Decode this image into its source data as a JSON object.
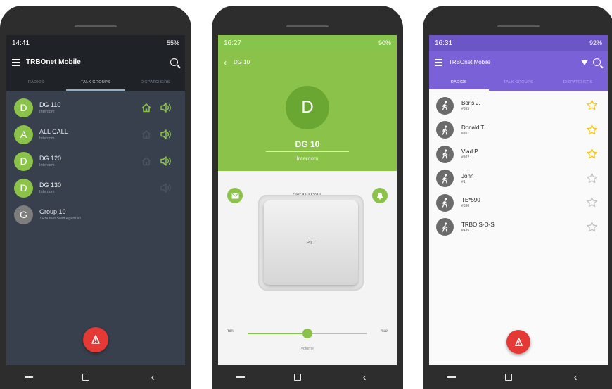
{
  "colors": {
    "dark_bg": "#37404c",
    "green": "#8bc34a",
    "purple": "#7b61d8",
    "red": "#e53935",
    "star_gold": "#f9c910"
  },
  "screen1": {
    "status": {
      "time": "14:41",
      "right": "55%"
    },
    "app_title": "TRBOnet Mobile",
    "tabs": [
      "RADIOS",
      "TALK GROUPS",
      "DISPATCHERS"
    ],
    "active_tab": "TALK GROUPS",
    "groups": [
      {
        "letter": "D",
        "name": "DG 110",
        "sub": "Intercom",
        "color": "#8bc34a",
        "house": "active",
        "speaker": "active"
      },
      {
        "letter": "A",
        "name": "ALL CALL",
        "sub": "Intercom",
        "color": "#8bc34a",
        "house": "dim",
        "speaker": "active"
      },
      {
        "letter": "D",
        "name": "DG 120",
        "sub": "Intercom",
        "color": "#8bc34a",
        "house": "dim",
        "speaker": "active"
      },
      {
        "letter": "D",
        "name": "DG 130",
        "sub": "Intercom",
        "color": "#8bc34a",
        "house": "none",
        "speaker": "dim"
      },
      {
        "letter": "G",
        "name": "Group 10",
        "sub": "TRBOnet Swift Agent #1",
        "color": "#7d7d7d",
        "house": "none",
        "speaker": "none"
      }
    ],
    "fab_icon": "emergency-alarm-icon"
  },
  "screen2": {
    "status": {
      "time": "16:27",
      "right": "90%"
    },
    "title": "DG 10",
    "avatar_letter": "D",
    "group_name": "DG 10",
    "group_sub": "Intercom",
    "call_label": "GROUP CALL",
    "ptt_label": "PTT",
    "volume": {
      "min_label": "min",
      "max_label": "max",
      "caption": "volume",
      "value": 0.5
    }
  },
  "screen3": {
    "status": {
      "time": "16:31",
      "right": "92%"
    },
    "app_title": "TRBOnet Mobile",
    "tabs": [
      "RADIOS",
      "TALK GROUPS",
      "DISPATCHERS"
    ],
    "active_tab": "RADIOS",
    "radios": [
      {
        "name": "Boris J.",
        "id": "#555",
        "starred": true
      },
      {
        "name": "Donald T.",
        "id": "#101",
        "starred": true
      },
      {
        "name": "Vlad P.",
        "id": "#102",
        "starred": true
      },
      {
        "name": "John",
        "id": "#1",
        "starred": false
      },
      {
        "name": "TE*590",
        "id": "#590",
        "starred": false
      },
      {
        "name": "TRBO.S-O-S",
        "id": "#435",
        "starred": false
      }
    ],
    "fab_icon": "emergency-alarm-icon"
  }
}
